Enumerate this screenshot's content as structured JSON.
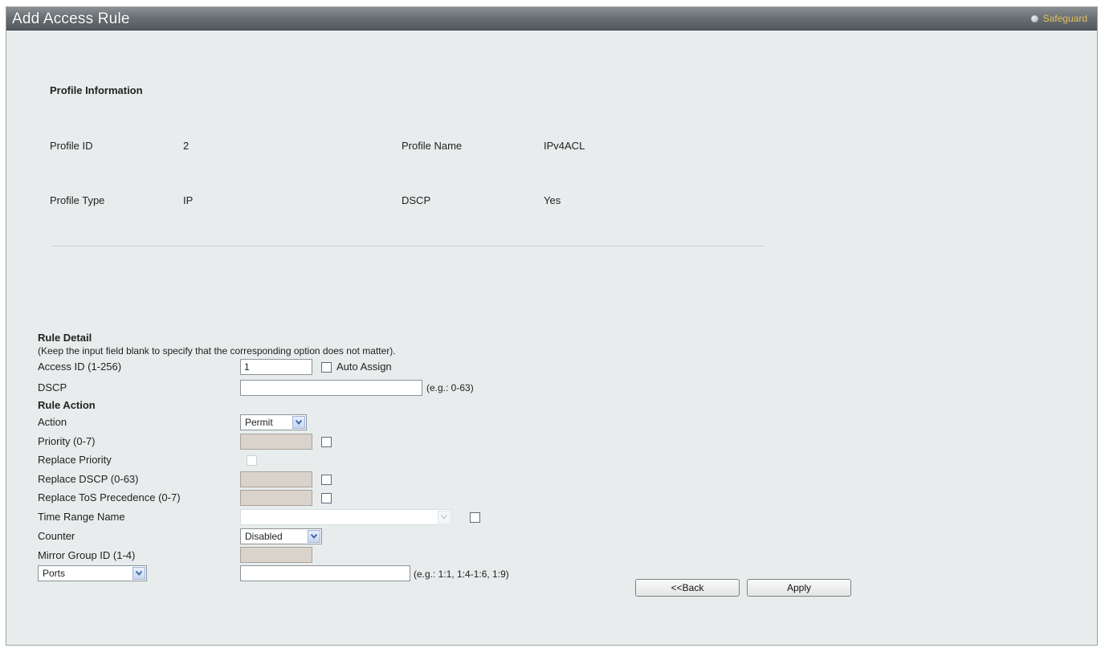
{
  "window": {
    "title": "Add Access Rule",
    "safeguard_label": "Safeguard"
  },
  "profile_info": {
    "heading": "Profile Information",
    "profile_id_label": "Profile ID",
    "profile_id_value": "2",
    "profile_name_label": "Profile Name",
    "profile_name_value": "IPv4ACL",
    "profile_type_label": "Profile Type",
    "profile_type_value": "IP",
    "dscp_label": "DSCP",
    "dscp_value": "Yes"
  },
  "rule_detail": {
    "heading": "Rule Detail",
    "note": "(Keep the input field blank to specify that the corresponding option does not matter).",
    "access_id_label": "Access ID (1-256)",
    "access_id_value": "1",
    "auto_assign_label": "Auto Assign",
    "dscp_label": "DSCP",
    "dscp_value": "",
    "dscp_hint": "(e.g.: 0-63)"
  },
  "rule_action": {
    "heading": "Rule Action",
    "action_label": "Action",
    "action_selected": "Permit",
    "priority_label": "Priority  (0-7)",
    "replace_priority_label": "Replace Priority",
    "replace_dscp_label": "Replace DSCP  (0-63)",
    "replace_tos_label": "Replace ToS Precedence  (0-7)",
    "time_range_label": "Time Range Name",
    "time_range_selected": "",
    "counter_label": "Counter",
    "counter_selected": "Disabled",
    "mirror_group_label": "Mirror Group ID (1-4)",
    "ports_selected": "Ports",
    "ports_value": "",
    "ports_hint": "(e.g.: 1:1, 1:4-1:6, 1:9)"
  },
  "buttons": {
    "back": "<<Back",
    "apply": "Apply"
  }
}
